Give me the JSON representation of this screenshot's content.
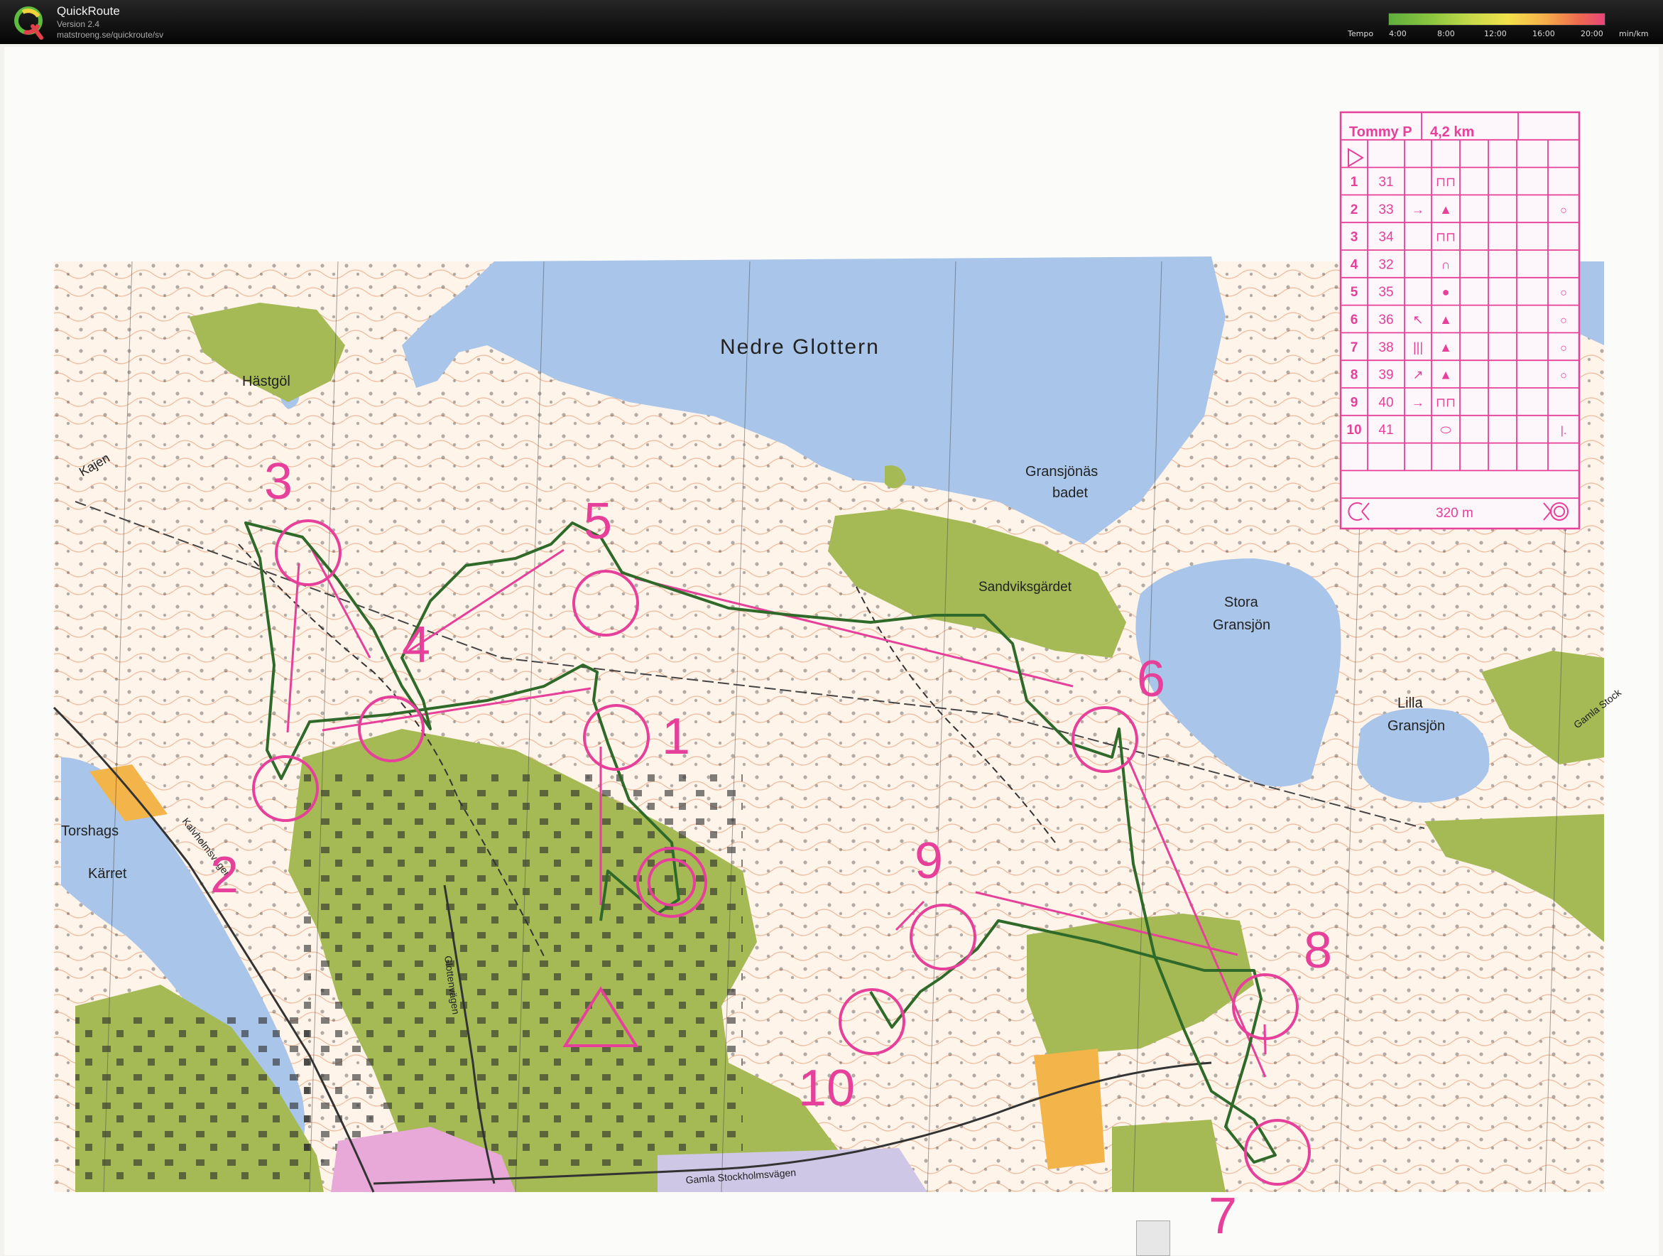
{
  "app": {
    "name": "QuickRoute",
    "version": "Version 2.4",
    "url": "matstroeng.se/quickroute/sv"
  },
  "tempo_scale": {
    "label": "Tempo",
    "ticks": [
      "4:00",
      "8:00",
      "12:00",
      "16:00",
      "20:00"
    ],
    "unit": "min/km"
  },
  "map_labels": {
    "lake_nedre_glottern": "Nedre Glottern",
    "hastgol": "Hästgöl",
    "kajen": "Kajen",
    "gransjonas_badet_1": "Gransjönäs",
    "gransjonas_badet_2": "badet",
    "sandviksgardet": "Sandviksgärdet",
    "stora_gransjon_1": "Stora",
    "stora_gransjon_2": "Gransjön",
    "lilla_gransjon_1": "Lilla",
    "lilla_gransjon_2": "Gransjön",
    "torshags": "Torshags",
    "karret": "Kärret",
    "kalvholmsvagen": "Kalvholmsvägen",
    "glottenvagen": "Glottenvägen",
    "gamla_stockholmsvagen": "Gamla Stockholmsvägen",
    "gamla_stock": "Gamla Stock"
  },
  "controls": [
    "1",
    "2",
    "3",
    "4",
    "5",
    "6",
    "7",
    "8",
    "9",
    "10"
  ],
  "description_card": {
    "runner": "Tommy P",
    "length": "4,2 km",
    "rows": [
      {
        "num": "1",
        "code": "31",
        "dir": "",
        "feature": "⊓⊓",
        "where": ""
      },
      {
        "num": "2",
        "code": "33",
        "dir": "→",
        "feature": "▲",
        "where": "○"
      },
      {
        "num": "3",
        "code": "34",
        "dir": "",
        "feature": "⊓⊓",
        "where": ""
      },
      {
        "num": "4",
        "code": "32",
        "dir": "",
        "feature": "∩",
        "where": ""
      },
      {
        "num": "5",
        "code": "35",
        "dir": "",
        "feature": "●",
        "where": "○"
      },
      {
        "num": "6",
        "code": "36",
        "dir": "↖",
        "feature": "▲",
        "where": "○"
      },
      {
        "num": "7",
        "code": "38",
        "dir": "|||",
        "feature": "▲",
        "where": "○"
      },
      {
        "num": "8",
        "code": "39",
        "dir": "↗",
        "feature": "▲",
        "where": "○"
      },
      {
        "num": "9",
        "code": "40",
        "dir": "→",
        "feature": "⊓⊓",
        "where": ""
      },
      {
        "num": "10",
        "code": "41",
        "dir": "",
        "feature": "⬭",
        "where": "|."
      }
    ],
    "finish_distance": "320 m"
  },
  "colors": {
    "water": "#a9c6ea",
    "forest_green": "#a5ba55",
    "open_yellow": "#f3b44a",
    "contour": "#d9794a",
    "course": "#e6409a",
    "route": "#2f6a2a",
    "paper": "#fbfbfa"
  }
}
